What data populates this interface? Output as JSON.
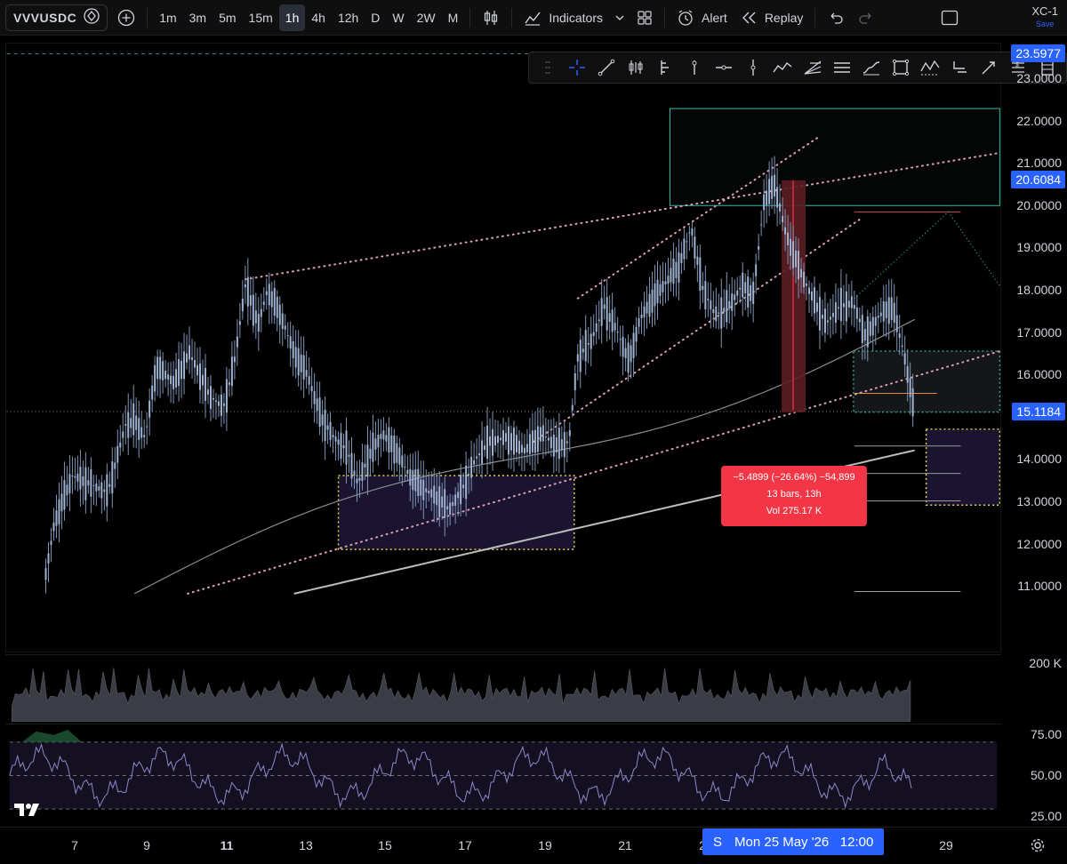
{
  "toolbar": {
    "symbol": "VVVUSDC",
    "intervals": [
      "1m",
      "3m",
      "5m",
      "15m",
      "1h",
      "4h",
      "12h",
      "D",
      "W",
      "2W",
      "M"
    ],
    "active_interval": "1h",
    "indicators_label": "Indicators",
    "alert_label": "Alert",
    "replay_label": "Replay",
    "layout_name": "XC-1",
    "layout_save": "Save"
  },
  "price_axis": {
    "labels": [
      "23.0000",
      "22.0000",
      "21.0000",
      "20.0000",
      "19.0000",
      "18.0000",
      "17.0000",
      "16.0000",
      "14.0000",
      "13.0000",
      "12.0000",
      "11.0000"
    ],
    "badge_top": "23.5977",
    "badge_mid": "20.6084",
    "badge_last": "15.1184",
    "badge_color": "#2962ff"
  },
  "measure": {
    "line1": "−5.4899 (−26.64%) −54,899",
    "line2": "13 bars, 13h",
    "line3": "Vol 275.17 K",
    "color": "#f23645"
  },
  "volume_axis": {
    "label": "200 K"
  },
  "rsi_axis": {
    "labels": [
      "75.00",
      "50.00",
      "25.00"
    ]
  },
  "time_axis": {
    "labels": [
      {
        "text": "7",
        "bold": false
      },
      {
        "text": "9",
        "bold": false
      },
      {
        "text": "11",
        "bold": true
      },
      {
        "text": "13",
        "bold": false
      },
      {
        "text": "15",
        "bold": false
      },
      {
        "text": "17",
        "bold": false
      },
      {
        "text": "19",
        "bold": false
      },
      {
        "text": "21",
        "bold": false
      },
      {
        "text": "2",
        "bold": false
      },
      {
        "text": "29",
        "bold": false
      }
    ],
    "crosshair_prefix": "S",
    "crosshair_label": "Mon 25 May '26   12:00"
  },
  "icons": [
    "search-diamond-icon",
    "add-symbol-icon",
    "candles-icon",
    "indicators-icon",
    "templates-icon",
    "alert-icon",
    "replay-icon",
    "undo-icon",
    "redo-icon",
    "fullscreen-icon",
    "settings-gear-icon",
    "tradingview-logo"
  ],
  "colors": {
    "background": "#000000",
    "candle": "#7f95b6",
    "ma_line": "#9a9a9a",
    "trend_dots": "#e0a0b8",
    "zone_fill": "#1a1430",
    "rsi_line": "#8f86c9"
  }
}
